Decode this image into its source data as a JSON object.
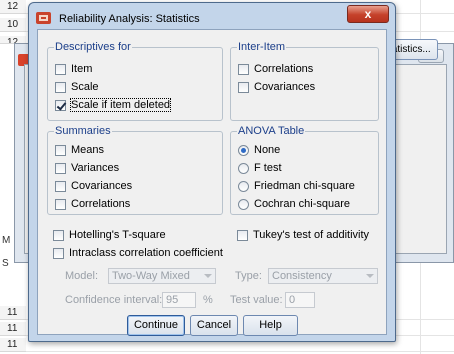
{
  "background": {
    "row_numbers": [
      "12",
      "10",
      "12",
      "11",
      "11",
      "11"
    ],
    "left_labels": [
      "M",
      "S"
    ],
    "dialog_statistics_button": "Statistics...",
    "dialog_close_glyph": "✕"
  },
  "dialog": {
    "title": "Reliability Analysis: Statistics",
    "close_glyph": "x",
    "accent_color": "#c5412a"
  },
  "descriptives": {
    "legend": "Descriptives for",
    "items": [
      {
        "label": "Item",
        "checked": false
      },
      {
        "label": "Scale",
        "checked": false
      },
      {
        "label": "Scale if item deleted",
        "checked": true
      }
    ]
  },
  "inter_item": {
    "legend": "Inter-Item",
    "items": [
      {
        "label": "Correlations",
        "checked": false
      },
      {
        "label": "Covariances",
        "checked": false
      }
    ]
  },
  "summaries": {
    "legend": "Summaries",
    "items": [
      {
        "label": "Means",
        "checked": false
      },
      {
        "label": "Variances",
        "checked": false
      },
      {
        "label": "Covariances",
        "checked": false
      },
      {
        "label": "Correlations",
        "checked": false
      }
    ]
  },
  "anova": {
    "legend": "ANOVA Table",
    "options": [
      {
        "label": "None",
        "selected": true
      },
      {
        "label": "F test",
        "selected": false
      },
      {
        "label": "Friedman chi-square",
        "selected": false
      },
      {
        "label": "Cochran chi-square",
        "selected": false
      }
    ]
  },
  "extras": {
    "hotelling": "Hotelling's T-square",
    "tukey": "Tukey's test of additivity",
    "intraclass": "Intraclass correlation coefficient"
  },
  "icc": {
    "model_label": "Model:",
    "model_value": "Two-Way Mixed",
    "type_label": "Type:",
    "type_value": "Consistency",
    "ci_label": "Confidence interval:",
    "ci_value": "95",
    "ci_unit": "%",
    "test_label": "Test value:",
    "test_value": "0"
  },
  "buttons": {
    "continue": "Continue",
    "cancel": "Cancel",
    "help": "Help"
  }
}
